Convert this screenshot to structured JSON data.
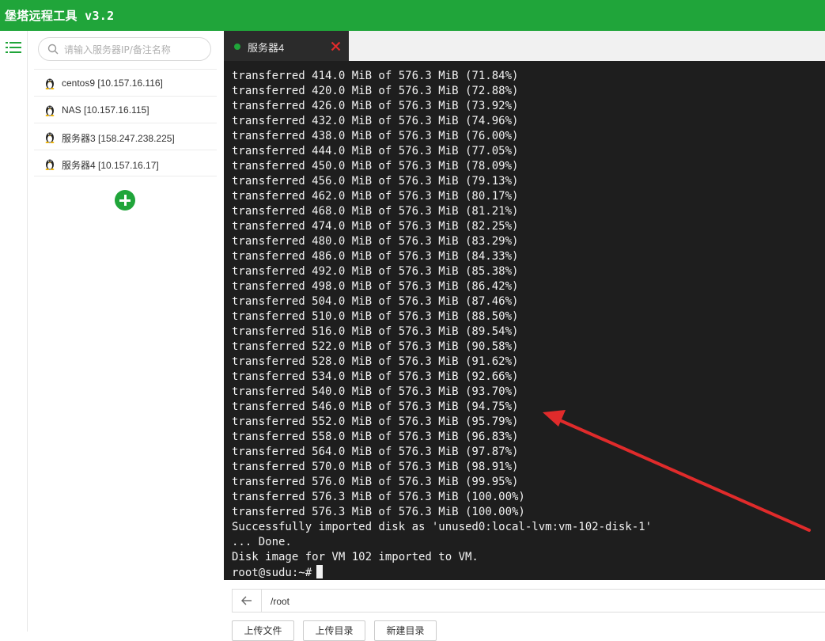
{
  "app": {
    "title": "堡塔远程工具 v3.2"
  },
  "sidebar": {
    "search": {
      "placeholder": "请输入服务器IP/备注名称",
      "value": ""
    },
    "servers": [
      {
        "label": "centos9 [10.157.16.116]"
      },
      {
        "label": "NAS [10.157.16.115]"
      },
      {
        "label": "服务器3 [158.247.238.225]"
      },
      {
        "label": "服务器4 [10.157.16.17]"
      }
    ]
  },
  "tabs": [
    {
      "label": "服务器4",
      "active": true
    }
  ],
  "terminal": {
    "lines": [
      "transferred 414.0 MiB of 576.3 MiB (71.84%)",
      "transferred 420.0 MiB of 576.3 MiB (72.88%)",
      "transferred 426.0 MiB of 576.3 MiB (73.92%)",
      "transferred 432.0 MiB of 576.3 MiB (74.96%)",
      "transferred 438.0 MiB of 576.3 MiB (76.00%)",
      "transferred 444.0 MiB of 576.3 MiB (77.05%)",
      "transferred 450.0 MiB of 576.3 MiB (78.09%)",
      "transferred 456.0 MiB of 576.3 MiB (79.13%)",
      "transferred 462.0 MiB of 576.3 MiB (80.17%)",
      "transferred 468.0 MiB of 576.3 MiB (81.21%)",
      "transferred 474.0 MiB of 576.3 MiB (82.25%)",
      "transferred 480.0 MiB of 576.3 MiB (83.29%)",
      "transferred 486.0 MiB of 576.3 MiB (84.33%)",
      "transferred 492.0 MiB of 576.3 MiB (85.38%)",
      "transferred 498.0 MiB of 576.3 MiB (86.42%)",
      "transferred 504.0 MiB of 576.3 MiB (87.46%)",
      "transferred 510.0 MiB of 576.3 MiB (88.50%)",
      "transferred 516.0 MiB of 576.3 MiB (89.54%)",
      "transferred 522.0 MiB of 576.3 MiB (90.58%)",
      "transferred 528.0 MiB of 576.3 MiB (91.62%)",
      "transferred 534.0 MiB of 576.3 MiB (92.66%)",
      "transferred 540.0 MiB of 576.3 MiB (93.70%)",
      "transferred 546.0 MiB of 576.3 MiB (94.75%)",
      "transferred 552.0 MiB of 576.3 MiB (95.79%)",
      "transferred 558.0 MiB of 576.3 MiB (96.83%)",
      "transferred 564.0 MiB of 576.3 MiB (97.87%)",
      "transferred 570.0 MiB of 576.3 MiB (98.91%)",
      "transferred 576.0 MiB of 576.3 MiB (99.95%)",
      "transferred 576.3 MiB of 576.3 MiB (100.00%)",
      "transferred 576.3 MiB of 576.3 MiB (100.00%)",
      "Successfully imported disk as 'unused0:local-lvm:vm-102-disk-1'",
      "... Done.",
      "Disk image for VM 102 imported to VM."
    ],
    "prompt": "root@sudu:~#"
  },
  "filebar": {
    "path": "/root",
    "buttons": [
      "上传文件",
      "上传目录",
      "新建目录"
    ]
  },
  "colors": {
    "brand": "#20a53a",
    "terminal_bg": "#1e1e1e",
    "annotation_arrow": "#e02b2b",
    "tab_close": "#e02b2b"
  },
  "icons": {
    "menu": "list-icon",
    "search": "search-icon",
    "server": "linux-penguin-icon",
    "add": "plus-circle-icon",
    "close": "close-icon",
    "back": "arrow-left-icon"
  }
}
